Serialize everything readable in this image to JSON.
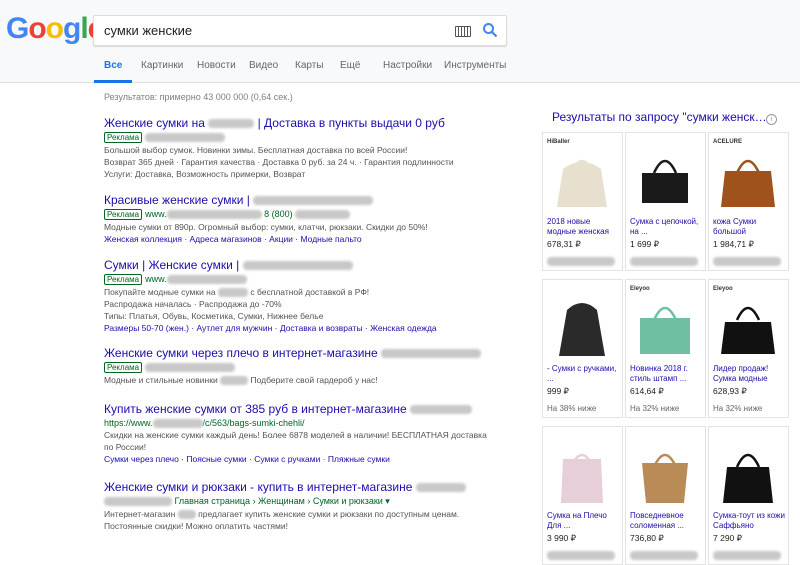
{
  "logo": {
    "letters": [
      {
        "c": "G",
        "color": "#4285f4"
      },
      {
        "c": "o",
        "color": "#ea4335"
      },
      {
        "c": "o",
        "color": "#fbbc05"
      },
      {
        "c": "g",
        "color": "#4285f4"
      },
      {
        "c": "l",
        "color": "#34a853"
      },
      {
        "c": "e",
        "color": "#ea4335"
      }
    ]
  },
  "search": {
    "query": "сумки женские"
  },
  "tabs": [
    "Все",
    "Картинки",
    "Новости",
    "Видео",
    "Карты",
    "Ещё",
    "Настройки",
    "Инструменты"
  ],
  "stats": "Результатов: примерно 43 000 000 (0,64 сек.)",
  "results": [
    {
      "title": "Женские сумки на",
      "title2": "| Доставка в пункты выдачи 0 руб",
      "ad": "Реклама",
      "lines": [
        "Большой выбор сумок. Новинки зимы. Бесплатная доставка по всей России!",
        "Возврат 365 дней · Гарантия качества · Доставка 0 руб. за 24 ч. · Гарантия подлинности",
        "Услуги: Доставка, Возможность примерки, Возврат"
      ]
    },
    {
      "title": "Красивые женские сумки |",
      "ad": "Реклама",
      "url": "www.",
      "url2": "8 (800)",
      "lines": [
        "Модные сумки от 890р. Огромный выбор: сумки, клатчи, рюкзаки. Скидки до 50%!"
      ],
      "links": "Женская коллекция · Адреса магазинов · Акции · Модные пальто"
    },
    {
      "title": "Сумки | Женские сумки |",
      "ad": "Реклама",
      "url": "www.",
      "lines": [
        "Покупайте модные сумки на",
        "с бесплатной доставкой в РФ!",
        "Распродажа началась · Распродажа до -70%",
        "Типы: Платья, Обувь, Косметика, Сумки, Нижнее белье"
      ],
      "links": "Размеры 50-70 (жен.) · Аутлет для мужчин · Доставка и возвраты · Женская одежда"
    },
    {
      "title": "Женские сумки через плечо в интернет-магазине",
      "ad": "Реклама",
      "lines": [
        "Модные и стильные новинки",
        "Подберите свой гардероб у нас!"
      ]
    },
    {
      "title": "Купить женские сумки от 385 руб в интернет-магазине",
      "url": "https://www.",
      "url2": "/c/563/bags-sumki-chehli/",
      "lines": [
        "Скидки на женские сумки каждый день! Более 6878 моделей в наличии! БЕСПЛАТНАЯ доставка",
        "по России!"
      ],
      "links": "Сумки через плечо · Поясные сумки · Сумки с ручками · Пляжные сумки"
    },
    {
      "title": "Женские сумки и рюкзаки - купить в интернет-магазине",
      "url2": "Главная страница › Женщинам › Сумки и рюкзаки ▾",
      "lines": [
        "Интернет-магазин",
        "предлагает купить женские сумки и рюкзаки по доступным ценам.",
        "Постоянные скидки! Можно оплатить частями!"
      ]
    }
  ],
  "shopping": {
    "title": "Результаты по запросу \"сумки женск…",
    "cards": [
      {
        "brand": "HiBaller",
        "name": "2018 новые модные женская",
        "price": "678,31 ₽",
        "color": "#e8e0cf"
      },
      {
        "brand": "",
        "name": "Сумка с цепочкой, на ...",
        "price": "1 699 ₽",
        "color": "#1a1a1a"
      },
      {
        "brand": "ACELURE",
        "name": "кожа Сумки большой",
        "price": "1 984,71 ₽",
        "color": "#a0521c"
      },
      {
        "brand": "",
        "name": "- Сумки с ручками, ...",
        "price": "999 ₽",
        "sub": "На 38% ниже",
        "color": "#2a2a2a"
      },
      {
        "brand": "Eleyoo",
        "name": "Новинка 2018 г. стиль штамп ...",
        "price": "614,64 ₽",
        "sub": "На 32% ниже",
        "color": "#6fbfa3"
      },
      {
        "brand": "Eleyoo",
        "name": "Лидер продаж! Сумка модные",
        "price": "628,93 ₽",
        "sub": "На 32% ниже",
        "color": "#111111"
      },
      {
        "brand": "",
        "name": "Сумка на Плечо Для ...",
        "price": "3 990 ₽",
        "color": "#e6cfd8"
      },
      {
        "brand": "",
        "name": "Повседневное соломенная ...",
        "price": "736,80 ₽",
        "color": "#b98b57"
      },
      {
        "brand": "",
        "name": "Сумка-тоут из кожи Саффьяно",
        "price": "7 290 ₽",
        "color": "#111111"
      }
    ]
  }
}
